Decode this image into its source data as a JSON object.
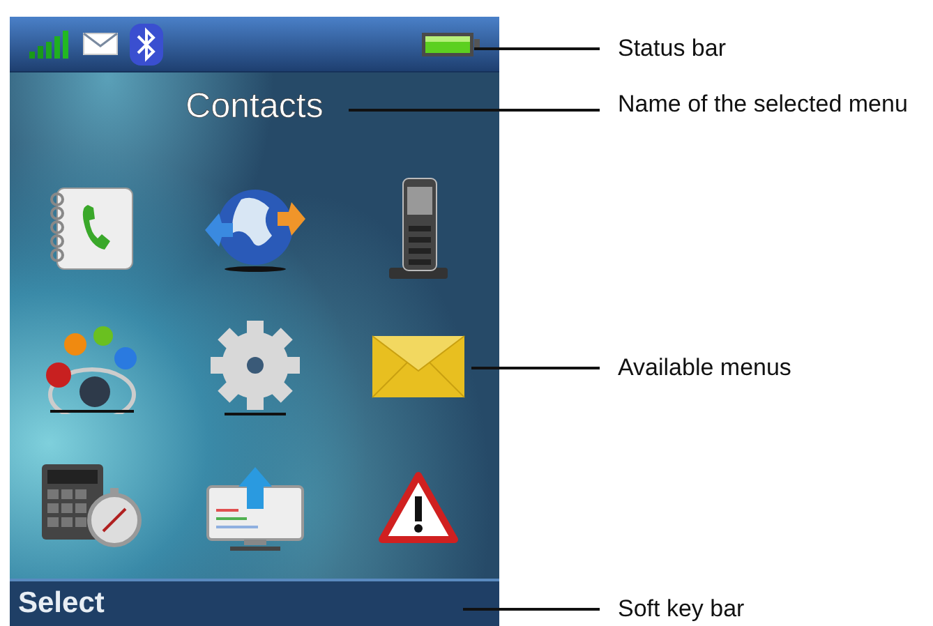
{
  "phone_screen": {
    "status_bar": {
      "icons": [
        {
          "kind": "signal"
        },
        {
          "kind": "message"
        },
        {
          "kind": "bluetooth"
        }
      ],
      "battery": {
        "kind": "battery"
      }
    },
    "menu_title": "Contacts",
    "menu_icons": [
      {
        "kind": "phonebook"
      },
      {
        "kind": "globe"
      },
      {
        "kind": "handset"
      },
      {
        "kind": "network"
      },
      {
        "kind": "gear"
      },
      {
        "kind": "envelope"
      },
      {
        "kind": "calculator"
      },
      {
        "kind": "monitor"
      },
      {
        "kind": "warning"
      }
    ],
    "soft_key_bar": {
      "left_key": "Select"
    }
  },
  "callouts": [
    {
      "label": "Status bar"
    },
    {
      "label": "Name of the selected menu"
    },
    {
      "label": "Available menus"
    },
    {
      "label": "Soft key bar"
    }
  ]
}
